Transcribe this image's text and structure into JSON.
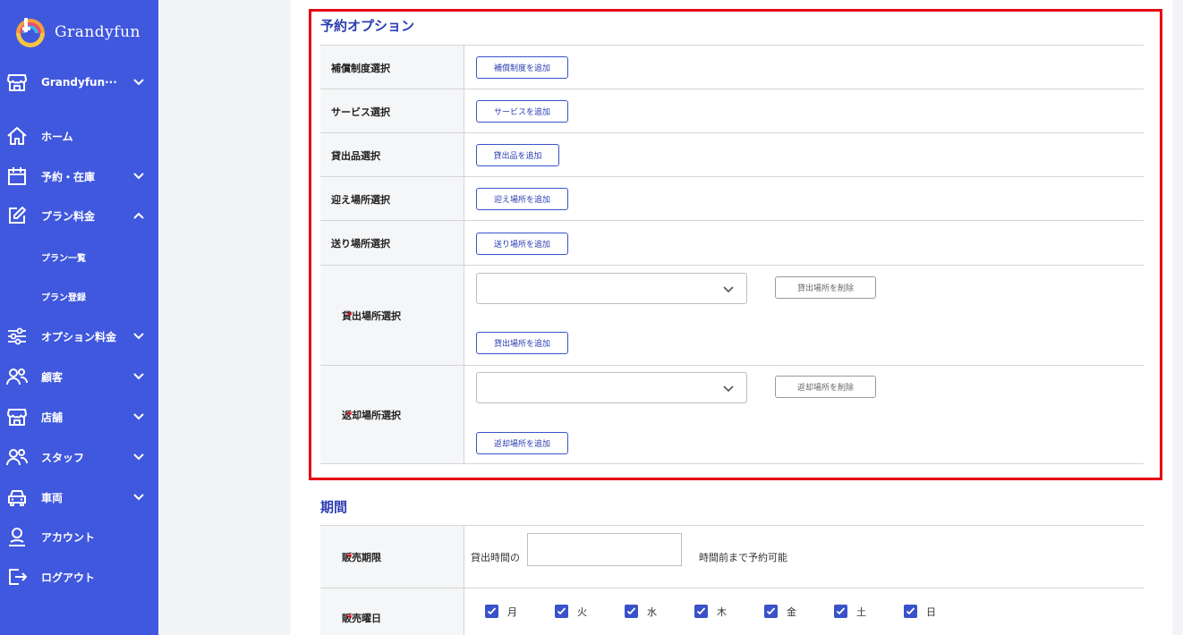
{
  "brand": {
    "name": "Grandyfun"
  },
  "sidebar": {
    "store_selector": "Grandyfun···",
    "items": [
      {
        "label": "ホーム",
        "icon": "home-icon"
      },
      {
        "label": "予約・在庫",
        "icon": "calendar-icon"
      },
      {
        "label": "プラン料金",
        "icon": "edit-icon"
      },
      {
        "label": "オプション料金",
        "icon": "sliders-icon"
      },
      {
        "label": "顧客",
        "icon": "users-icon"
      },
      {
        "label": "店舗",
        "icon": "store-icon"
      },
      {
        "label": "スタッフ",
        "icon": "users-icon"
      },
      {
        "label": "車両",
        "icon": "car-icon"
      },
      {
        "label": "アカウント",
        "icon": "user-icon"
      },
      {
        "label": "ログアウト",
        "icon": "logout-icon"
      }
    ],
    "subitems": [
      {
        "label": "プラン一覧"
      },
      {
        "label": "プラン登録"
      }
    ]
  },
  "options_section": {
    "title": "予約オプション",
    "rows": [
      {
        "label": "補償制度選択",
        "button": "補償制度を追加"
      },
      {
        "label": "サービス選択",
        "button": "サービスを追加"
      },
      {
        "label": "貸出品選択",
        "button": "貸出品を追加"
      },
      {
        "label": "迎え場所選択",
        "button": "迎え場所を追加"
      },
      {
        "label": "送り場所選択",
        "button": "送り場所を追加"
      }
    ],
    "lending_place": {
      "label": "貸出場所選択",
      "delete": "貸出場所を削除",
      "add": "貸出場所を追加"
    },
    "return_place": {
      "label": "返却場所選択",
      "delete": "返却場所を削除",
      "add": "返却場所を追加"
    },
    "required_mark": "*"
  },
  "period_section": {
    "title": "期間",
    "sales_limit": {
      "label": "販売期限",
      "prefix": "貸出時間の",
      "value": "",
      "suffix": "時間前まで予約可能"
    },
    "sales_days": {
      "label": "販売曜日",
      "days": [
        {
          "label": "月",
          "checked": true
        },
        {
          "label": "火",
          "checked": true
        },
        {
          "label": "水",
          "checked": true
        },
        {
          "label": "木",
          "checked": true
        },
        {
          "label": "金",
          "checked": true
        },
        {
          "label": "土",
          "checked": true
        },
        {
          "label": "日",
          "checked": true
        }
      ]
    }
  },
  "colors": {
    "sidebar": "#4058dd",
    "accent": "#2a3db0",
    "highlight": "#e60012"
  }
}
